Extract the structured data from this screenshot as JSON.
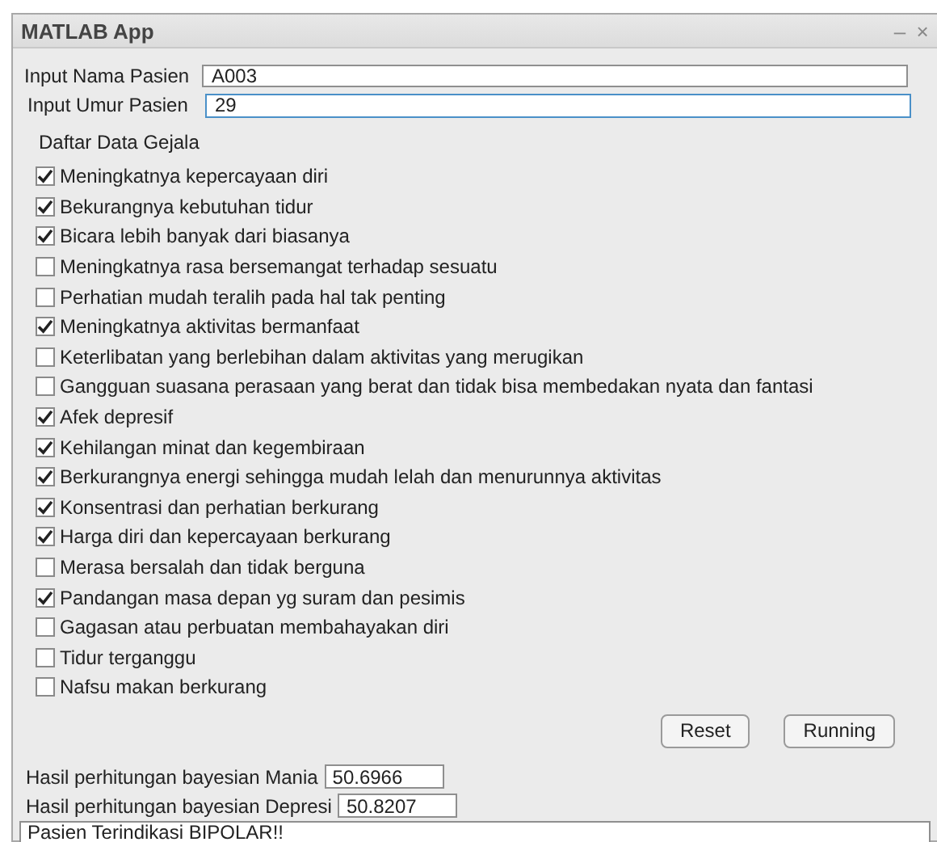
{
  "window": {
    "title": "MATLAB App",
    "controls": [
      "–",
      "×"
    ]
  },
  "inputs": [
    {
      "label": "Input Nama Pasien",
      "value": "A003",
      "focused": false
    },
    {
      "label": "Input Umur Pasien",
      "value": "29",
      "focused": true
    }
  ],
  "symptoms_heading": "Daftar Data Gejala",
  "symptoms": [
    {
      "label": "Meningkatnya kepercayaan diri",
      "checked": true
    },
    {
      "label": "Bekurangnya kebutuhan tidur",
      "checked": true
    },
    {
      "label": "Bicara lebih banyak dari biasanya",
      "checked": true
    },
    {
      "label": "Meningkatnya rasa bersemangat terhadap sesuatu",
      "checked": false
    },
    {
      "label": "Perhatian mudah teralih pada hal tak penting",
      "checked": false
    },
    {
      "label": "Meningkatnya aktivitas bermanfaat",
      "checked": true
    },
    {
      "label": "Keterlibatan yang berlebihan dalam aktivitas yang merugikan",
      "checked": false
    },
    {
      "label": "Gangguan suasana perasaan yang berat dan tidak bisa membedakan nyata dan fantasi",
      "checked": false
    },
    {
      "label": "Afek depresif",
      "checked": true
    },
    {
      "label": "Kehilangan minat dan kegembiraan",
      "checked": true
    },
    {
      "label": "Berkurangnya energi sehingga mudah lelah dan menurunnya aktivitas",
      "checked": true
    },
    {
      "label": "Konsentrasi dan perhatian berkurang",
      "checked": true
    },
    {
      "label": "Harga diri dan kepercayaan berkurang",
      "checked": true
    },
    {
      "label": "Merasa bersalah dan tidak berguna",
      "checked": false
    },
    {
      "label": "Pandangan masa depan yg suram dan pesimis",
      "checked": true
    },
    {
      "label": "Gagasan atau perbuatan membahayakan diri",
      "checked": false
    },
    {
      "label": "Tidur terganggu",
      "checked": false
    },
    {
      "label": "Nafsu makan berkurang",
      "checked": false
    }
  ],
  "buttons": [
    "Reset",
    "Running"
  ],
  "results": [
    {
      "label": "Hasil perhitungan bayesian Mania",
      "value": "50.6966"
    },
    {
      "label": "Hasil perhitungan bayesian Depresi",
      "value": "50.8207"
    }
  ],
  "conclusion": "Pasien Terindikasi BIPOLAR!!"
}
